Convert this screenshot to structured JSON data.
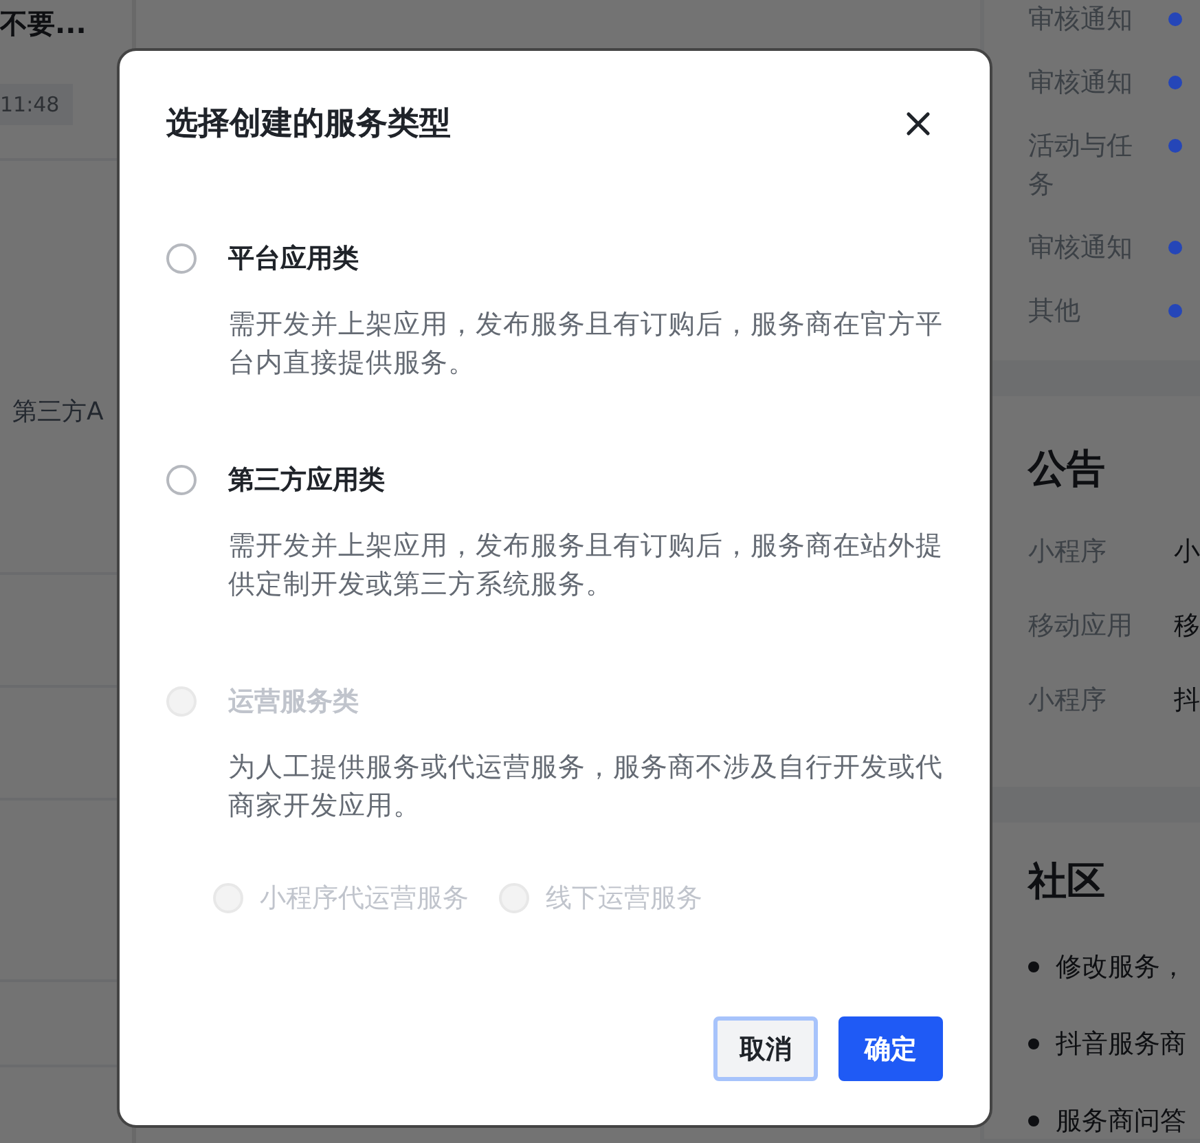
{
  "background": {
    "conversation": {
      "title": "不要...",
      "time": "11:48",
      "snippet": "第三方A"
    },
    "notifications": [
      {
        "label": "审核通知",
        "color": "#2546b8"
      },
      {
        "label": "审核通知",
        "color": "#2546b8"
      },
      {
        "label": "活动与任务",
        "color": "#2546b8"
      },
      {
        "label": "审核通知",
        "color": "#2546b8"
      },
      {
        "label": "其他",
        "color": "#2546b8"
      }
    ],
    "announcements": {
      "title": "公告",
      "rows": [
        {
          "category": "小程序",
          "text": "小"
        },
        {
          "category": "移动应用",
          "text": "移"
        },
        {
          "category": "小程序",
          "text": "抖"
        }
      ]
    },
    "community": {
      "title": "社区",
      "items": [
        "修改服务，",
        "抖音服务商",
        "服务商问答"
      ]
    }
  },
  "dialog": {
    "title": "选择创建的服务类型",
    "options": [
      {
        "label": "平台应用类",
        "description": "需开发并上架应用，发布服务且有订购后，服务商在官方平台内直接提供服务。",
        "selected": false,
        "disabled": false
      },
      {
        "label": "第三方应用类",
        "description": "需开发并上架应用，发布服务且有订购后，服务商在站外提供定制开发或第三方系统服务。",
        "selected": false,
        "disabled": false
      },
      {
        "label": "运营服务类",
        "description": "为人工提供服务或代运营服务，服务商不涉及自行开发或代商家开发应用。",
        "selected": false,
        "disabled": true,
        "children": [
          {
            "label": "小程序代运营服务",
            "selected": false,
            "disabled": true
          },
          {
            "label": "线下运营服务",
            "selected": false,
            "disabled": true
          }
        ]
      }
    ],
    "buttons": [
      {
        "label": "取消",
        "kind": "secondary",
        "focused": true
      },
      {
        "label": "确定",
        "kind": "primary",
        "focused": false
      }
    ]
  }
}
